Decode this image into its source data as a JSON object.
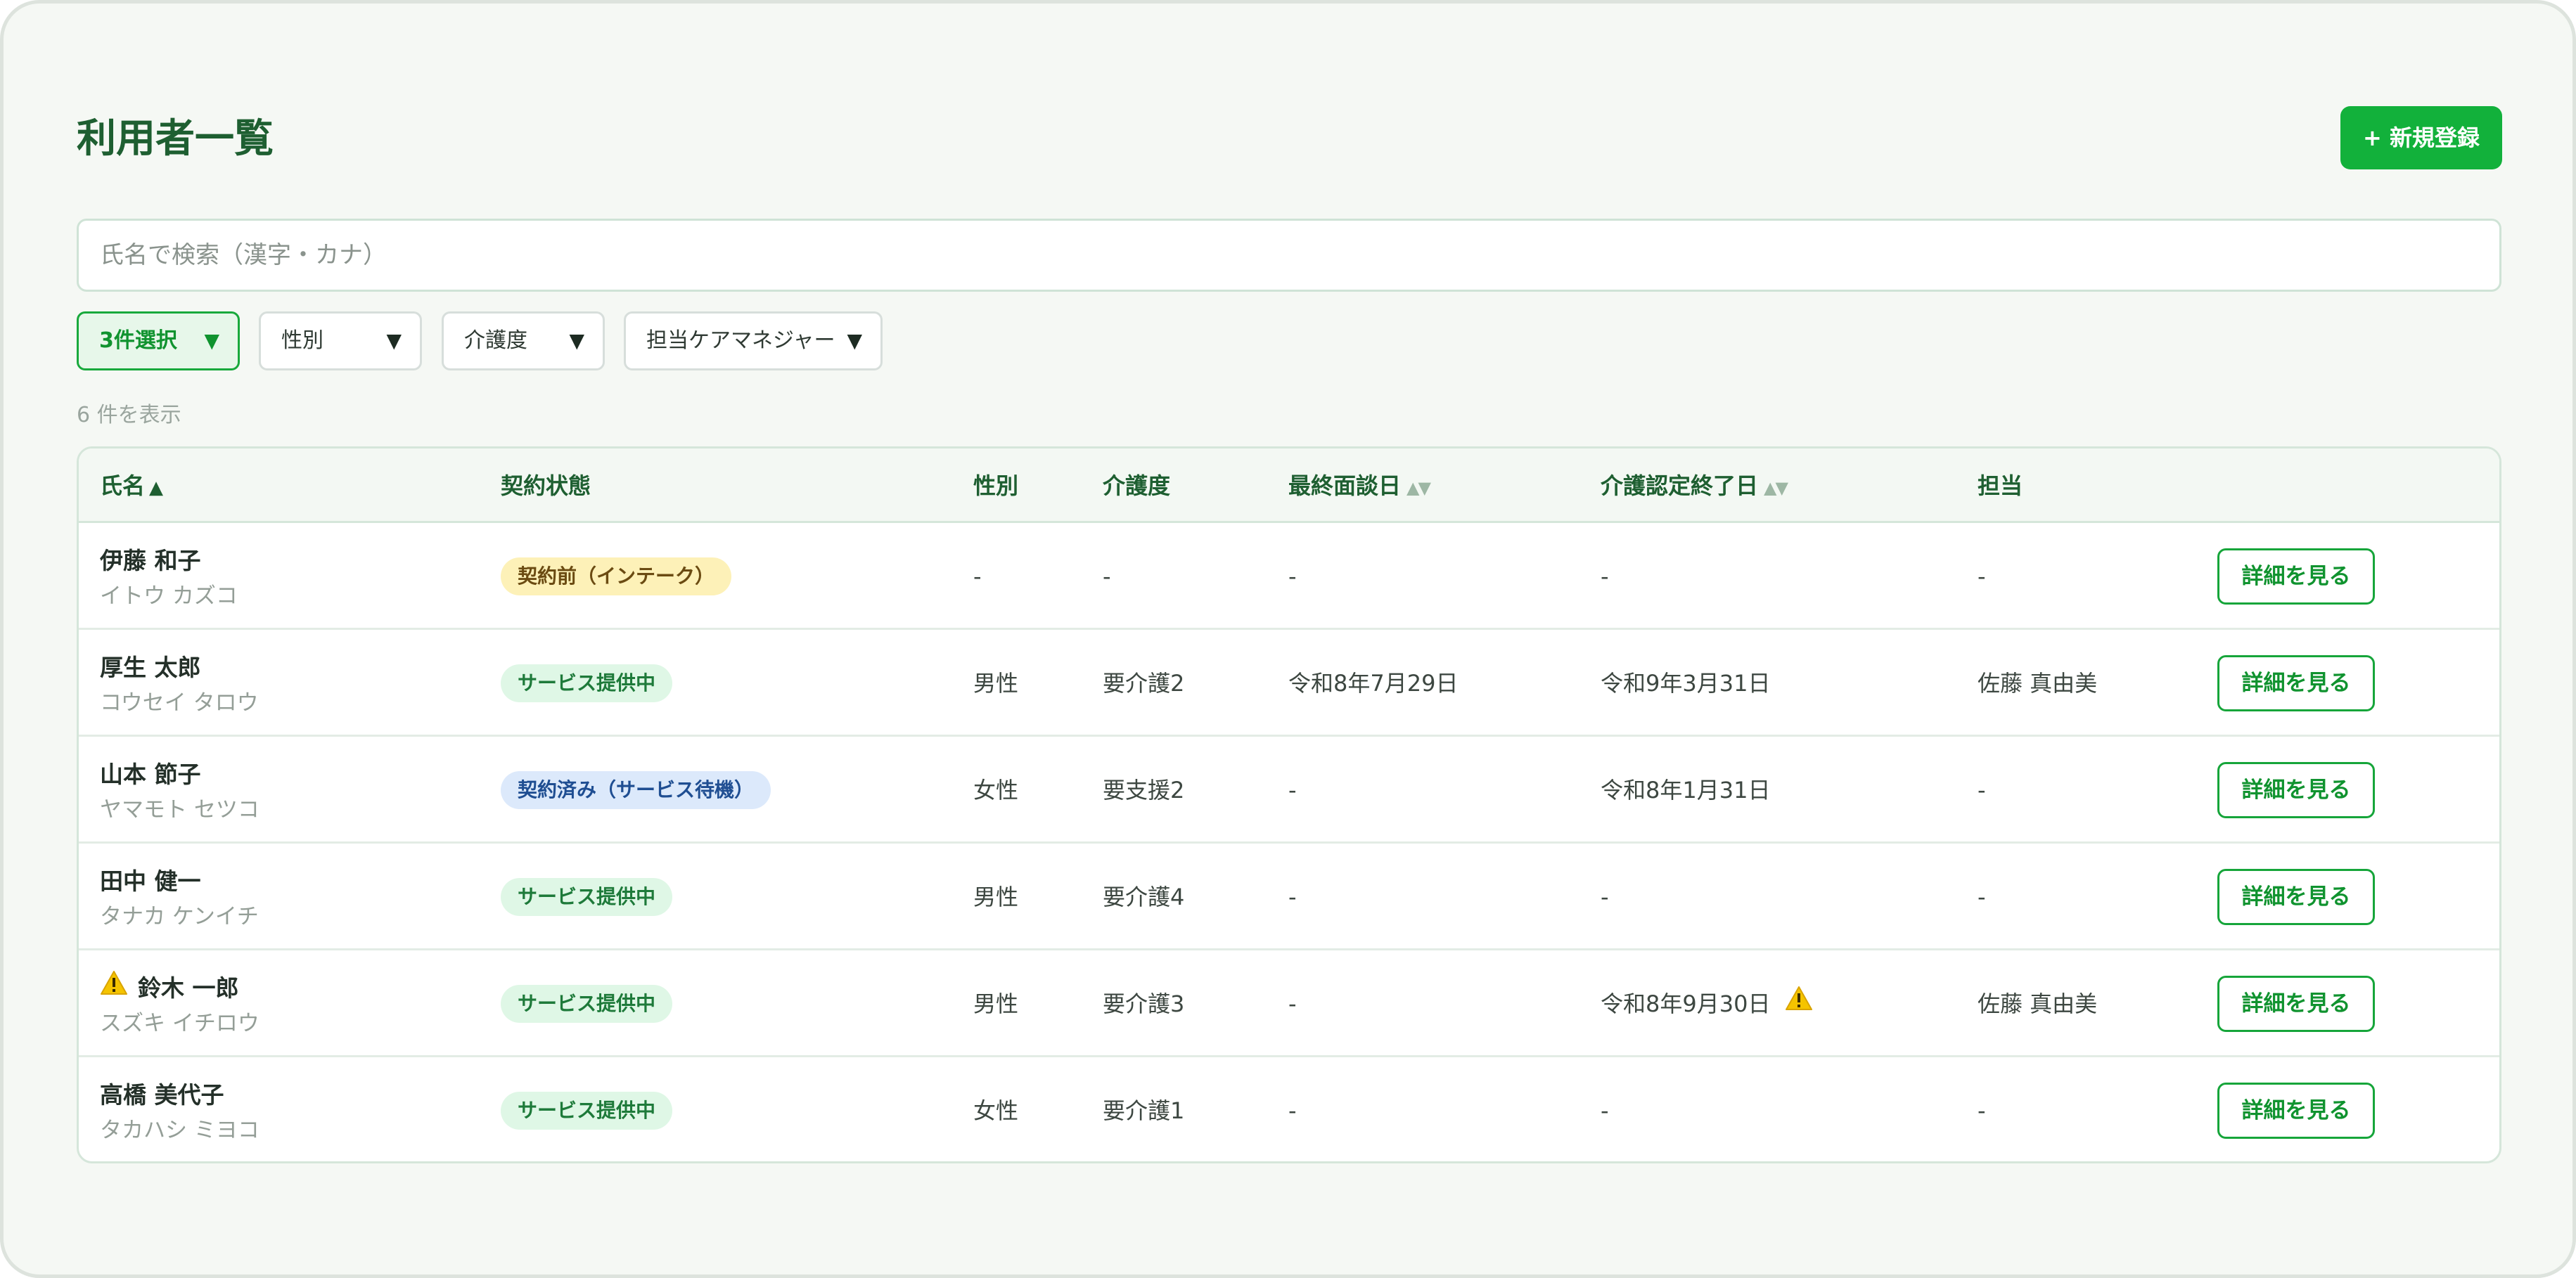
{
  "page": {
    "title": "利用者一覧",
    "new_button_label": "+ 新規登録"
  },
  "search": {
    "placeholder": "氏名で検索（漢字・カナ）",
    "value": ""
  },
  "filters": [
    {
      "label": "3件選択",
      "active": true
    },
    {
      "label": "性別",
      "active": false
    },
    {
      "label": "介護度",
      "active": false
    },
    {
      "label": "担当ケアマネジャー",
      "active": false
    }
  ],
  "result_count": "6 件を表示",
  "table": {
    "headers": {
      "name": "氏名",
      "contract": "契約状態",
      "gender": "性別",
      "care_level": "介護度",
      "last_interview": "最終面談日",
      "cert_end": "介護認定終了日",
      "manager": "担当"
    },
    "detail_label": "詳細を見る",
    "rows": [
      {
        "name": "伊藤 和子",
        "kana": "イトウ カズコ",
        "contract": "契約前（インテーク）",
        "contract_type": "intake",
        "gender": "-",
        "care_level": "-",
        "last_interview": "-",
        "cert_end": "-",
        "manager": "-",
        "name_warning": false,
        "cert_warning": false
      },
      {
        "name": "厚生 太郎",
        "kana": "コウセイ タロウ",
        "contract": "サービス提供中",
        "contract_type": "active",
        "gender": "男性",
        "care_level": "要介護2",
        "last_interview": "令和8年7月29日",
        "cert_end": "令和9年3月31日",
        "manager": "佐藤 真由美",
        "name_warning": false,
        "cert_warning": false
      },
      {
        "name": "山本 節子",
        "kana": "ヤマモト セツコ",
        "contract": "契約済み（サービス待機）",
        "contract_type": "waiting",
        "gender": "女性",
        "care_level": "要支援2",
        "last_interview": "-",
        "cert_end": "令和8年1月31日",
        "manager": "-",
        "name_warning": false,
        "cert_warning": false
      },
      {
        "name": "田中 健一",
        "kana": "タナカ ケンイチ",
        "contract": "サービス提供中",
        "contract_type": "active",
        "gender": "男性",
        "care_level": "要介護4",
        "last_interview": "-",
        "cert_end": "-",
        "manager": "-",
        "name_warning": false,
        "cert_warning": false
      },
      {
        "name": "鈴木 一郎",
        "kana": "スズキ イチロウ",
        "contract": "サービス提供中",
        "contract_type": "active",
        "gender": "男性",
        "care_level": "要介護3",
        "last_interview": "-",
        "cert_end": "令和8年9月30日",
        "manager": "佐藤 真由美",
        "name_warning": true,
        "cert_warning": true
      },
      {
        "name": "高橋 美代子",
        "kana": "タカハシ ミヨコ",
        "contract": "サービス提供中",
        "contract_type": "active",
        "gender": "女性",
        "care_level": "要介護1",
        "last_interview": "-",
        "cert_end": "-",
        "manager": "-",
        "name_warning": false,
        "cert_warning": false
      }
    ]
  },
  "colors": {
    "accent": "#12b13b",
    "title": "#1e5f31",
    "warning": "#f5c400"
  },
  "icons": {
    "warning": "warning-triangle-icon",
    "dropdown": "caret-down-icon",
    "sort_asc": "sort-ascending-icon",
    "sort_both": "sort-toggle-icon"
  }
}
